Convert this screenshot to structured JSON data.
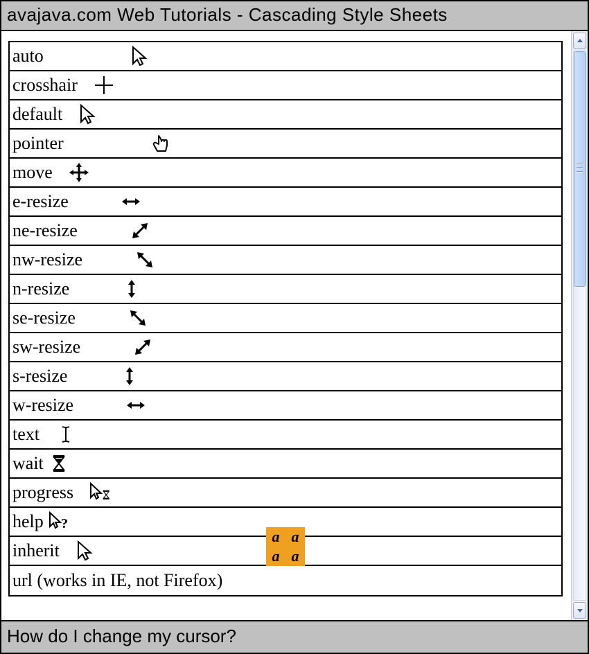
{
  "window": {
    "title": "avajava.com Web Tutorials - Cascading Style Sheets"
  },
  "status": {
    "text": "How do I change my cursor?"
  },
  "cursors": [
    {
      "label": "auto",
      "icon": "cursor-default-icon",
      "offset": "far"
    },
    {
      "label": "crosshair",
      "icon": "cursor-crosshair-icon",
      "offset": "near"
    },
    {
      "label": "default",
      "icon": "cursor-default-icon",
      "offset": "near"
    },
    {
      "label": "pointer",
      "icon": "cursor-pointer-icon",
      "offset": "far"
    },
    {
      "label": "move",
      "icon": "cursor-move-icon",
      "offset": "near"
    },
    {
      "label": "e-resize",
      "icon": "cursor-ew-resize-icon",
      "offset": "mid"
    },
    {
      "label": "ne-resize",
      "icon": "cursor-nesw-resize-icon",
      "offset": "mid"
    },
    {
      "label": "nw-resize",
      "icon": "cursor-nwse-resize-icon",
      "offset": "mid"
    },
    {
      "label": "n-resize",
      "icon": "cursor-ns-resize-icon",
      "offset": "mid"
    },
    {
      "label": "se-resize",
      "icon": "cursor-nwse-resize-icon",
      "offset": "mid"
    },
    {
      "label": "sw-resize",
      "icon": "cursor-nesw-resize-icon",
      "offset": "mid"
    },
    {
      "label": "s-resize",
      "icon": "cursor-ns-resize-icon",
      "offset": "mid"
    },
    {
      "label": "w-resize",
      "icon": "cursor-ew-resize-icon",
      "offset": "mid"
    },
    {
      "label": "text",
      "icon": "cursor-text-icon",
      "offset": "near"
    },
    {
      "label": "wait",
      "icon": "cursor-wait-icon",
      "offset": "tight"
    },
    {
      "label": "progress",
      "icon": "cursor-progress-icon",
      "offset": "near"
    },
    {
      "label": "help",
      "icon": "cursor-help-icon",
      "offset": "tight"
    },
    {
      "label": "inherit",
      "icon": "cursor-default-icon",
      "offset": "near",
      "badge": true
    },
    {
      "label": "url (works in IE, not Firefox)",
      "icon": null
    }
  ],
  "badgeGlyph": "a"
}
